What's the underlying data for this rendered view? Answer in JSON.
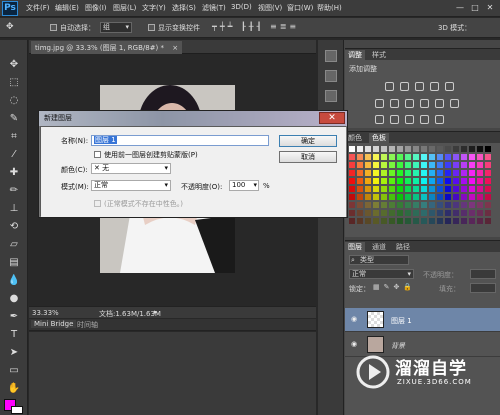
{
  "app": {
    "logo": "Ps"
  },
  "menu": [
    "文件(F)",
    "编辑(E)",
    "图像(I)",
    "图层(L)",
    "文字(Y)",
    "选择(S)",
    "滤镜(T)",
    "3D(D)",
    "视图(V)",
    "窗口(W)",
    "帮助(H)"
  ],
  "window_controls": {
    "minimize": "—",
    "maximize": "□",
    "close": "✕"
  },
  "options": {
    "auto_select_label": "自动选择：",
    "auto_select_value": "组",
    "show_transform_label": "显示变换控件",
    "mode_3d_label": "3D 模式："
  },
  "document": {
    "tab_title": "timg.jpg @ 33.3% (图层 1, RGB/8#) *",
    "tab_close": "×",
    "zoom": "33.33%",
    "doc_info": "文档:1.63M/1.63M"
  },
  "mini_tabs": [
    "Mini Bridge",
    "时间轴"
  ],
  "panels": {
    "adjust_tabs": [
      "调整",
      "样式"
    ],
    "adjust_title": "添加调整",
    "swatch_tabs": [
      "颜色",
      "色板"
    ],
    "layers_tabs": [
      "图层",
      "通道",
      "路径"
    ],
    "layers_kind": "类型",
    "blend_mode": "正常",
    "opacity_label": "不透明度：",
    "lock_label": "锁定：",
    "fill_label": "填充：",
    "layers": [
      {
        "name": "图层 1",
        "selected": true
      },
      {
        "name": "背景",
        "selected": false
      }
    ]
  },
  "dialog": {
    "title": "新建图层",
    "close": "✕",
    "name_label": "名称(N):",
    "name_value": "图层 1",
    "clip_label": "使用前一图层创建剪贴蒙版(P)",
    "color_label": "颜色(C):",
    "color_value": "无",
    "mode_label": "模式(M):",
    "mode_value": "正常",
    "opacity_label": "不透明度(O):",
    "opacity_value": "100",
    "opacity_unit": "%",
    "neutral_label": "(正常模式不存在中性色。)",
    "ok_button": "确定",
    "cancel_button": "取消"
  },
  "watermark": {
    "brand": "溜溜自学",
    "url": "ZIXUE.3D66.COM"
  },
  "colors": {
    "accent": "#2c8ad7",
    "foreground": "#ff00ff",
    "background": "#ffffff"
  }
}
